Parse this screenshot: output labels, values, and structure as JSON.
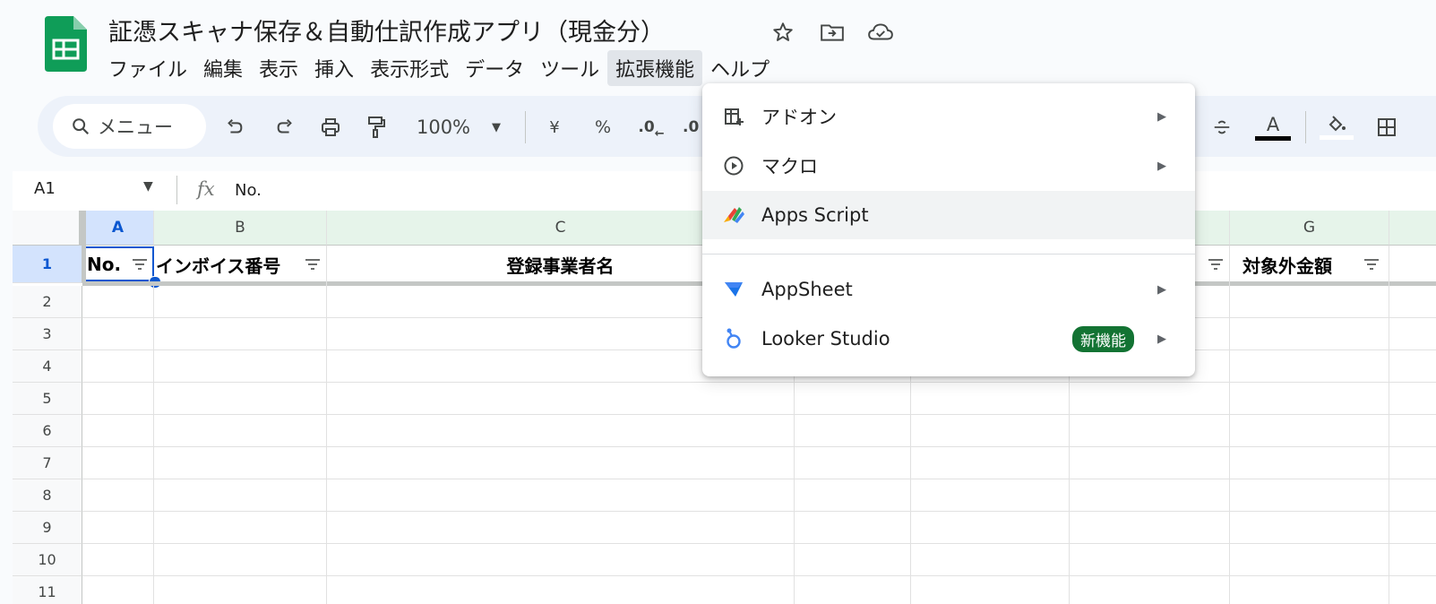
{
  "header": {
    "title": "証憑スキャナ保存＆自動仕訳作成アプリ（現金分）",
    "title_icons": [
      "star-icon",
      "move-to-folder-icon",
      "cloud-saved-icon"
    ]
  },
  "menubar": [
    {
      "label": "ファイル"
    },
    {
      "label": "編集"
    },
    {
      "label": "表示"
    },
    {
      "label": "挿入"
    },
    {
      "label": "表示形式"
    },
    {
      "label": "データ"
    },
    {
      "label": "ツール"
    },
    {
      "label": "拡張機能"
    },
    {
      "label": "ヘルプ"
    }
  ],
  "toolbar": {
    "menu_search_label": "メニュー",
    "zoom": "100%",
    "currency": "¥",
    "percent": "%",
    "decimal_decrease": ".0",
    "decimal_increase": ".0",
    "text_color_letter": "A"
  },
  "formula_bar": {
    "cell_ref": "A1",
    "fx": "fx",
    "value": "No."
  },
  "sheet": {
    "columns": [
      {
        "label": "A"
      },
      {
        "label": "B"
      },
      {
        "label": "C"
      },
      {
        "label": ""
      },
      {
        "label": ""
      },
      {
        "label": ""
      },
      {
        "label": "G"
      }
    ],
    "header_row": [
      "No.",
      "インボイス番号",
      "登録事業者名",
      "",
      "",
      "",
      "対象外金額"
    ],
    "rows": [
      "1",
      "2",
      "3",
      "4",
      "5",
      "6",
      "7",
      "8",
      "9",
      "10",
      "11"
    ]
  },
  "extensions_menu": {
    "items": [
      {
        "label": "アドオン",
        "icon": "addon-icon",
        "submenu": true
      },
      {
        "label": "マクロ",
        "icon": "macro-play-icon",
        "submenu": true
      },
      {
        "label": "Apps Script",
        "icon": "apps-script-icon",
        "submenu": false
      },
      {
        "label": "AppSheet",
        "icon": "appsheet-icon",
        "submenu": true
      },
      {
        "label": "Looker Studio",
        "icon": "looker-studio-icon",
        "submenu": true,
        "badge": "新機能"
      }
    ]
  },
  "colors": {
    "sheets_green": "#0f9d58",
    "selection_blue": "#0b57d0",
    "badge_green": "#137333",
    "toolbar_bg": "#edf2fa"
  }
}
